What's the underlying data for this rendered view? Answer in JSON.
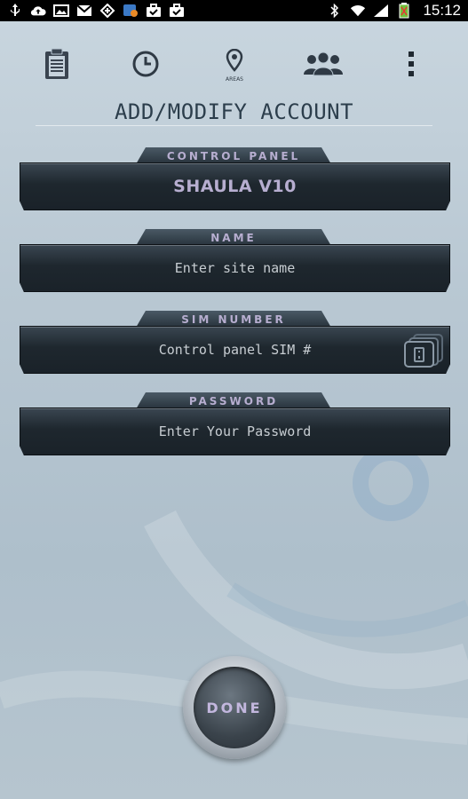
{
  "status_bar": {
    "time": "15:12",
    "left_icons": [
      "usb-icon",
      "cloud-upload-icon",
      "image-icon",
      "gmail-icon",
      "transfer-icon",
      "notification-badge-icon",
      "briefcase-check-icon",
      "briefcase-check-icon"
    ],
    "right_icons": [
      "bluetooth-icon",
      "wifi-icon",
      "signal-icon",
      "battery-icon"
    ]
  },
  "action_bar": {
    "items": [
      {
        "name": "clipboard-icon"
      },
      {
        "name": "clock-icon"
      },
      {
        "name": "location-pin-icon",
        "caption": "AREAS"
      },
      {
        "name": "users-group-icon"
      },
      {
        "name": "overflow-menu-icon"
      }
    ]
  },
  "page": {
    "title": "ADD/MODIFY ACCOUNT"
  },
  "fields": {
    "control_panel": {
      "label": "CONTROL PANEL",
      "value": "SHAULA V10"
    },
    "name": {
      "label": "NAME",
      "placeholder": "Enter site name"
    },
    "sim": {
      "label": "SIM NUMBER",
      "placeholder": "Control panel SIM #",
      "icon": "sim-card-icon"
    },
    "password": {
      "label": "PASSWORD",
      "placeholder": "Enter Your Password"
    }
  },
  "done_button": {
    "label": "DONE"
  },
  "colors": {
    "label_text": "#b7aed0",
    "field_bg": "#1e272e",
    "title_text": "#2c3e4c",
    "background": "#b9c8d3"
  }
}
